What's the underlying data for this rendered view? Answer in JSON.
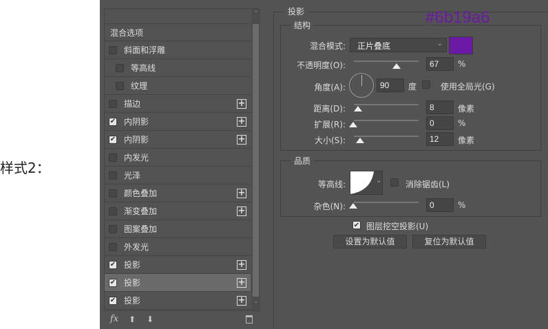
{
  "caption": "样式2：",
  "annotation": "#6b19a6",
  "list": {
    "header": "混合选项",
    "items": [
      {
        "label": "斜面和浮雕",
        "checked": false,
        "plus": false,
        "indent": false
      },
      {
        "label": "等高线",
        "checked": false,
        "plus": false,
        "indent": true
      },
      {
        "label": "纹理",
        "checked": false,
        "plus": false,
        "indent": true
      },
      {
        "label": "描边",
        "checked": false,
        "plus": true,
        "indent": false
      },
      {
        "label": "内阴影",
        "checked": true,
        "plus": true,
        "indent": false
      },
      {
        "label": "内阴影",
        "checked": true,
        "plus": true,
        "indent": false
      },
      {
        "label": "内发光",
        "checked": false,
        "plus": false,
        "indent": false
      },
      {
        "label": "光泽",
        "checked": false,
        "plus": false,
        "indent": false
      },
      {
        "label": "颜色叠加",
        "checked": false,
        "plus": true,
        "indent": false
      },
      {
        "label": "渐变叠加",
        "checked": false,
        "plus": true,
        "indent": false
      },
      {
        "label": "图案叠加",
        "checked": false,
        "plus": false,
        "indent": false
      },
      {
        "label": "外发光",
        "checked": false,
        "plus": false,
        "indent": false
      },
      {
        "label": "投影",
        "checked": true,
        "plus": true,
        "indent": false
      },
      {
        "label": "投影",
        "checked": true,
        "plus": true,
        "indent": false,
        "selected": true
      },
      {
        "label": "投影",
        "checked": true,
        "plus": true,
        "indent": false
      }
    ],
    "fx": "fx"
  },
  "shadow": {
    "title": "投影",
    "structure": {
      "title": "结构",
      "blend_label": "混合模式:",
      "blend_value": "正片叠底",
      "color": "#6b19a6",
      "opacity_label": "不透明度(O):",
      "opacity": "67",
      "opacity_unit": "%",
      "angle_label": "角度(A):",
      "angle": "90",
      "angle_unit": "度",
      "global_light": "使用全局光(G)",
      "distance_label": "距离(D):",
      "distance": "8",
      "distance_unit": "像素",
      "spread_label": "扩展(R):",
      "spread": "0",
      "spread_unit": "%",
      "size_label": "大小(S):",
      "size": "12",
      "size_unit": "像素"
    },
    "quality": {
      "title": "品质",
      "contour_label": "等高线:",
      "antialias": "消除锯齿(L)",
      "noise_label": "杂色(N):",
      "noise": "0",
      "noise_unit": "%"
    },
    "knockout": "图层挖空投影(U)",
    "set_default": "设置为默认值",
    "reset_default": "复位为默认值"
  }
}
